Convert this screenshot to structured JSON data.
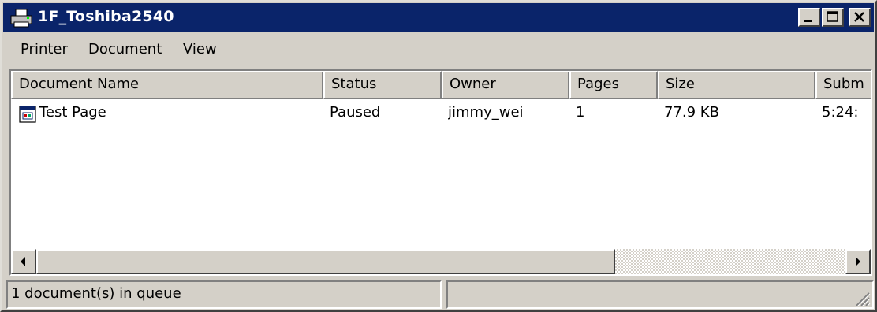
{
  "window": {
    "title": "1F_Toshiba2540",
    "title_icon": "printer-icon",
    "controls": [
      "minimize-icon",
      "maximize-icon",
      "close-icon"
    ]
  },
  "menu": [
    "Printer",
    "Document",
    "View"
  ],
  "columns": [
    "Document Name",
    "Status",
    "Owner",
    "Pages",
    "Size",
    "Subm"
  ],
  "rows": [
    {
      "name": "Test Page",
      "status": "Paused",
      "owner": "jimmy_wei",
      "pages": "1",
      "size": "77.9 KB",
      "submitted": "5:24:"
    }
  ],
  "status": {
    "text": "1 document(s) in queue",
    "pane2": ""
  },
  "colors": {
    "titlebar": "#0a246a",
    "face": "#d4d0c8"
  }
}
